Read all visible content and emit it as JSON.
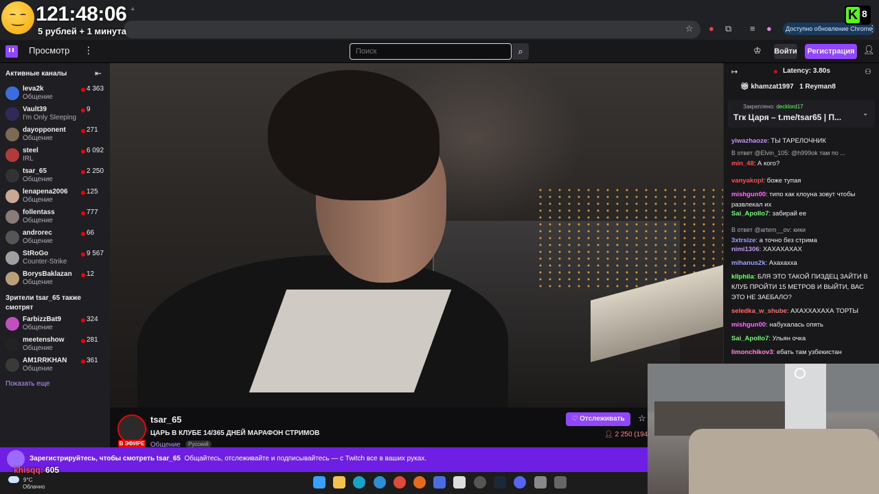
{
  "overlay": {
    "timer": "121:48:06",
    "timer_plus": "+",
    "subtitle": "5 рублей + 1 минута",
    "donor_name": "khisqq:",
    "donor_amount": "605",
    "k_badge": "K",
    "k_count": "8"
  },
  "chrome": {
    "update_text": "Доступно обновление Chrome"
  },
  "nav": {
    "browse": "Просмотр",
    "search_placeholder": "Поиск",
    "login": "Войти",
    "signup": "Регистрация"
  },
  "sidebar": {
    "title": "Активные каналы",
    "channels": [
      {
        "name": "leva2k",
        "category": "Общение",
        "viewers": "4 363",
        "color": "#3c6de0"
      },
      {
        "name": "Vault39",
        "category": "I'm Only Sleeping",
        "viewers": "9",
        "color": "#2f2a5a"
      },
      {
        "name": "dayopponent",
        "category": "Общение",
        "viewers": "271",
        "color": "#7d6a55"
      },
      {
        "name": "steel",
        "category": "IRL",
        "viewers": "6 092",
        "color": "#b13b3b"
      },
      {
        "name": "tsar_65",
        "category": "Общение",
        "viewers": "2 250",
        "color": "#333"
      },
      {
        "name": "lenapena2006",
        "category": "Общение",
        "viewers": "125",
        "color": "#c9a895"
      },
      {
        "name": "follentass",
        "category": "Общение",
        "viewers": "777",
        "color": "#8a7a7a"
      },
      {
        "name": "androrec",
        "category": "Общение",
        "viewers": "66",
        "color": "#555"
      },
      {
        "name": "StRoGo",
        "category": "Counter-Strike",
        "viewers": "9 567",
        "color": "#a0a0a0"
      },
      {
        "name": "BorysBaklazan",
        "category": "Общение",
        "viewers": "12",
        "color": "#b8a078"
      }
    ],
    "subtitle": "Зрители tsar_65 также смотрят",
    "also": [
      {
        "name": "FarbizzBat9",
        "category": "Общение",
        "viewers": "324",
        "color": "#c04fc0"
      },
      {
        "name": "meetenshow",
        "category": "Общение",
        "viewers": "281",
        "color": "#222"
      },
      {
        "name": "AM1RRKHAN",
        "category": "Общение",
        "viewers": "361",
        "color": "#3a3a3a"
      }
    ],
    "show_more": "Показать еще"
  },
  "stream": {
    "channel": "tsar_65",
    "title": "ЦАРЬ В КЛУБЕ 14/365 ДНЕЙ МАРАФОН СТРИМОВ",
    "category": "Общение",
    "language": "Русский",
    "live": "В ЭФИРЕ",
    "follow": "Отслеживать",
    "viewers": "2 250 (194"
  },
  "chat": {
    "latency": "Latency: 3.80s",
    "gift_users": [
      "khamzat1997",
      "1",
      "Reyman8"
    ],
    "pinned_label": "Закреплено:",
    "pinned_by": "decklord17",
    "pinned_text": "Тгк Царя – t.me/tsar65 | П...",
    "messages": [
      {
        "reply": "",
        "user": "yiwazhaoze",
        "color": "#bf94ff",
        "text": ": ТЫ ТАРЕЛОЧНИК"
      },
      {
        "reply": "В ответ @Elvin_105: @h999ok там по ...",
        "user": "min_48",
        "color": "#ff4d4d",
        "text": ": А кого?"
      },
      {
        "reply": "",
        "user": "vanyakopl",
        "color": "#ff4d4d",
        "text": ": боже тупая"
      },
      {
        "reply": "",
        "user": "mishgun00",
        "color": "#ff6bff",
        "text": ": типо как клоуна зовут чтобы развлекал их"
      },
      {
        "reply": "",
        "user": "Sai_Apollo7",
        "color": "#6bff6b",
        "text": ": забирай ее"
      },
      {
        "reply": "В ответ @artem__ov: кики",
        "user": "3xtrsize",
        "color": "#9aa0ff",
        "text": ": а точно без стрима"
      },
      {
        "reply": "",
        "user": "nimi1306",
        "color": "#bf94ff",
        "text": ": ХАХАХАХАХ"
      },
      {
        "reply": "",
        "user": "mihanus2k",
        "color": "#a0a0ff",
        "text": ": Ахахахха"
      },
      {
        "reply": "",
        "user": "kllphila",
        "color": "#6bff6b",
        "text": ": БЛЯ ЭТО ТАКОЙ ПИЗДЕЦ ЗАЙТИ В КЛУБ ПРОЙТИ 15 МЕТРОВ И ВЫЙТИ, ВАС ЭТО НЕ ЗАЕБАЛО?"
      },
      {
        "reply": "",
        "user": "seledka_w_shube",
        "color": "#ff6b6b",
        "text": ": АХАХХАХАХА ТОРТЫ"
      },
      {
        "reply": "",
        "user": "mishgun00",
        "color": "#ff6bff",
        "text": ": набухалась опять"
      },
      {
        "reply": "",
        "user": "Sai_Apollo7",
        "color": "#6bff6b",
        "text": ": Ульян очка"
      },
      {
        "reply": "",
        "user": "limonchikov3",
        "color": "#ff8ad8",
        "text": ": ебать там узбекистан"
      }
    ]
  },
  "banner": {
    "bold": "Зарегистрируйтесь, чтобы смотреть tsar_65",
    "text": "Общайтесь, отслеживайте и подписывайтесь — с Twitch все в ваших руках."
  },
  "taskbar": {
    "temp": "9°C",
    "weather": "Облачно"
  }
}
